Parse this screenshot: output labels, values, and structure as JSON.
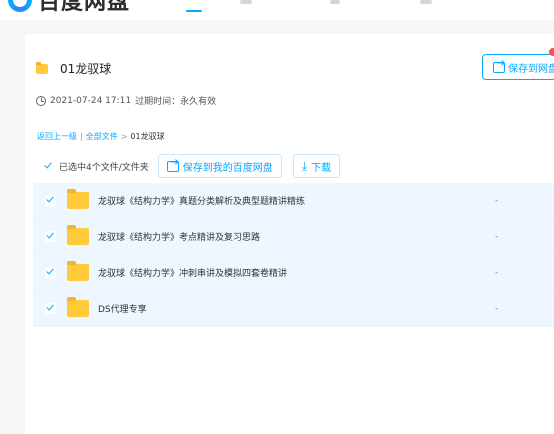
{
  "header": {
    "logo_text": "百度网盘"
  },
  "share": {
    "title": "01龙驭球",
    "save_button": "保存到网盘",
    "datetime": "2021-07-24 17:11",
    "expire_label": "过期时间：永久有效"
  },
  "breadcrumb": {
    "back": "返回上一级",
    "separator": "|",
    "all_files": "全部文件",
    "arrow": ">",
    "current": "01龙驭球"
  },
  "toolbar": {
    "selected_text": "已选中4个文件/文件夹",
    "save_label": "保存到我的百度网盘",
    "download_label": "下载"
  },
  "files": [
    {
      "name": "龙驭球《结构力学》真题分类解析及典型题精讲精练",
      "size": "-"
    },
    {
      "name": "龙驭球《结构力学》考点精讲及复习思路",
      "size": "-"
    },
    {
      "name": "龙驭球《结构力学》冲刺串讲及模拟四套卷精讲",
      "size": "-"
    },
    {
      "name": "DS代理专享",
      "size": "-"
    }
  ],
  "colors": {
    "accent": "#06a7ff",
    "selected_row": "#eef6ff",
    "folder": "#ffcb3a",
    "badge": "#f35252"
  }
}
